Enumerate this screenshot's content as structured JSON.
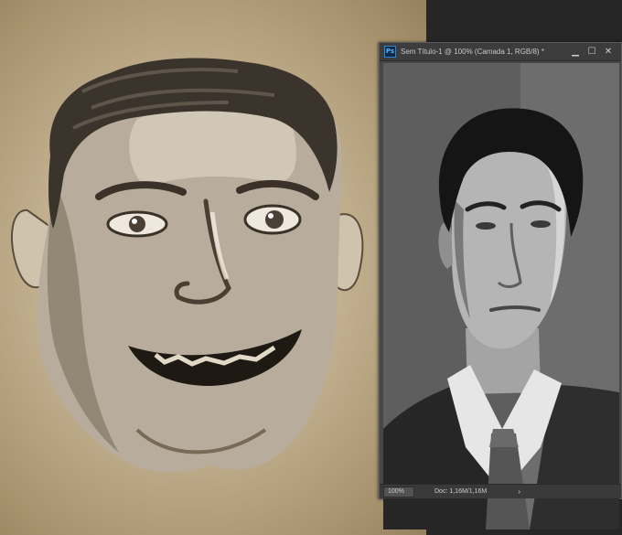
{
  "canvas": {
    "subject": "painted-caricature"
  },
  "document_window": {
    "app_icon": "photoshop-icon",
    "app_icon_text": "Ps",
    "title": "Sem Título-1 @ 100% (Camada 1, RGB/8) *",
    "buttons": {
      "minimize": "▁",
      "maximize": "☐",
      "close": "✕"
    },
    "photo": {
      "subject": "black-and-white-portrait"
    },
    "status": {
      "zoom": "100%",
      "doc_size": "Doc: 1,16M/1,16M",
      "arrow": "›"
    }
  },
  "colors": {
    "paper": "#c3b08f",
    "workspace": "#262626",
    "window_frame": "#474747"
  }
}
